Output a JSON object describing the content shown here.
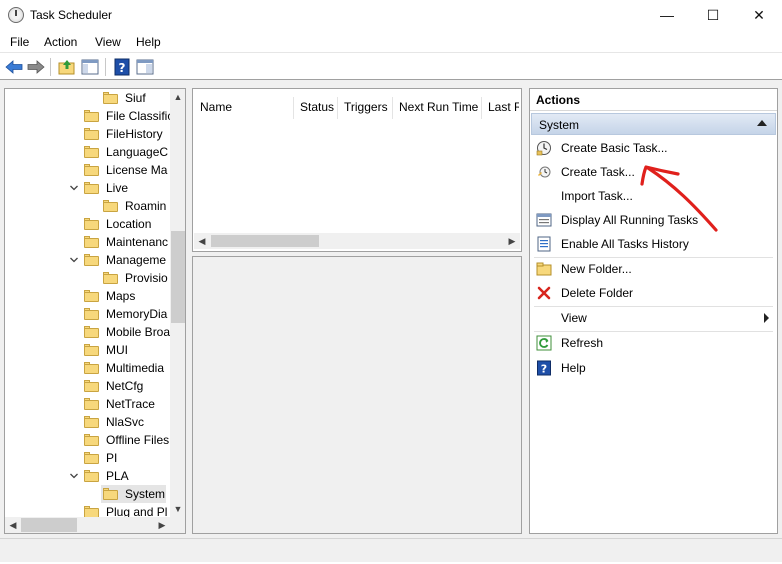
{
  "window": {
    "title": "Task Scheduler"
  },
  "menu": [
    "File",
    "Action",
    "View",
    "Help"
  ],
  "tree": {
    "items": [
      {
        "label": "Siuf",
        "indent": 1,
        "expand": ""
      },
      {
        "label": "File Classific",
        "indent": 0,
        "expand": ""
      },
      {
        "label": "FileHistory",
        "indent": 0,
        "expand": ""
      },
      {
        "label": "LanguageC",
        "indent": 0,
        "expand": ""
      },
      {
        "label": "License Ma",
        "indent": 0,
        "expand": ""
      },
      {
        "label": "Live",
        "indent": 0,
        "expand": "open"
      },
      {
        "label": "Roamin",
        "indent": 1,
        "expand": ""
      },
      {
        "label": "Location",
        "indent": 0,
        "expand": ""
      },
      {
        "label": "Maintenanc",
        "indent": 0,
        "expand": ""
      },
      {
        "label": "Manageme",
        "indent": 0,
        "expand": "open"
      },
      {
        "label": "Provisio",
        "indent": 1,
        "expand": ""
      },
      {
        "label": "Maps",
        "indent": 0,
        "expand": ""
      },
      {
        "label": "MemoryDia",
        "indent": 0,
        "expand": ""
      },
      {
        "label": "Mobile Broa",
        "indent": 0,
        "expand": ""
      },
      {
        "label": "MUI",
        "indent": 0,
        "expand": ""
      },
      {
        "label": "Multimedia",
        "indent": 0,
        "expand": ""
      },
      {
        "label": "NetCfg",
        "indent": 0,
        "expand": ""
      },
      {
        "label": "NetTrace",
        "indent": 0,
        "expand": ""
      },
      {
        "label": "NlaSvc",
        "indent": 0,
        "expand": ""
      },
      {
        "label": "Offline Files",
        "indent": 0,
        "expand": ""
      },
      {
        "label": "PI",
        "indent": 0,
        "expand": ""
      },
      {
        "label": "PLA",
        "indent": 0,
        "expand": "open"
      },
      {
        "label": "System",
        "indent": 1,
        "expand": "",
        "selected": true
      },
      {
        "label": "Plug and Pl",
        "indent": 0,
        "expand": ""
      }
    ]
  },
  "task_list": {
    "columns": [
      "Name",
      "Status",
      "Triggers",
      "Next Run Time",
      "Last R"
    ]
  },
  "actions": {
    "header": "Actions",
    "section": "System",
    "items": [
      {
        "label": "Create Basic Task...",
        "icon": "create-basic-task-icon"
      },
      {
        "label": "Create Task...",
        "icon": "create-task-icon"
      },
      {
        "label": "Import Task...",
        "icon": ""
      },
      {
        "label": "Display All Running Tasks",
        "icon": "running-tasks-icon"
      },
      {
        "label": "Enable All Tasks History",
        "icon": "tasks-history-icon"
      },
      {
        "label": "New Folder...",
        "icon": "new-folder-icon"
      },
      {
        "label": "Delete Folder",
        "icon": "delete-icon"
      },
      {
        "label": "View",
        "icon": "",
        "submenu": true
      },
      {
        "label": "Refresh",
        "icon": "refresh-icon"
      },
      {
        "label": "Help",
        "icon": "help-icon"
      }
    ]
  },
  "colors": {
    "accent": "#2e6fc7",
    "annotation": "#e0201c",
    "folder": "#f7d87c"
  }
}
